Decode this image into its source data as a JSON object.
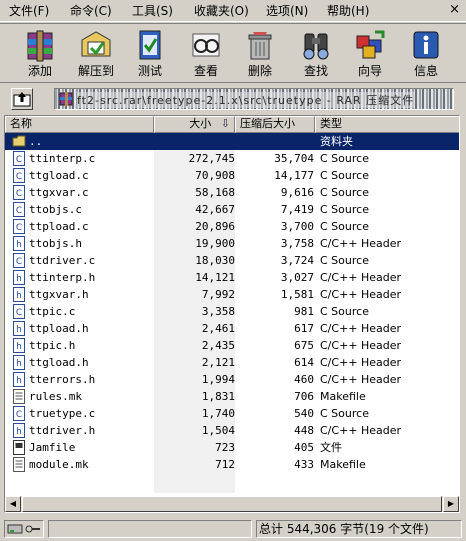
{
  "menu": {
    "items": [
      "文件(F)",
      "命令(C)",
      "工具(S)",
      "收藏夹(O)",
      "选项(N)",
      "帮助(H)"
    ],
    "close_glyph": "×"
  },
  "toolbar": {
    "buttons": [
      {
        "label": "添加",
        "icon": "add-archive-icon"
      },
      {
        "label": "解压到",
        "icon": "extract-to-icon"
      },
      {
        "label": "测试",
        "icon": "test-icon"
      },
      {
        "label": "查看",
        "icon": "view-icon"
      },
      {
        "label": "删除",
        "icon": "delete-icon"
      },
      {
        "label": "查找",
        "icon": "find-icon"
      },
      {
        "label": "向导",
        "icon": "wizard-icon"
      },
      {
        "label": "信息",
        "icon": "info-icon"
      }
    ]
  },
  "address": {
    "up_icon": "up-folder-icon",
    "path": "ft2-src.rar\\freetype-2.1.x\\src\\truetype - RAR 压缩文件"
  },
  "list": {
    "columns": {
      "name": "名称",
      "size": "大小",
      "packed": "压缩后大小",
      "type": "类型"
    },
    "sort_indicator": "⇩",
    "rows": [
      {
        "name": "..",
        "size": "",
        "packed": "",
        "type": "资料夹",
        "icon": "folder-up-icon",
        "selected": true
      },
      {
        "name": "ttinterp.c",
        "size": "272,745",
        "packed": "35,704",
        "type": "C Source",
        "icon": "c-file-icon"
      },
      {
        "name": "ttgload.c",
        "size": "70,908",
        "packed": "14,177",
        "type": "C Source",
        "icon": "c-file-icon"
      },
      {
        "name": "ttgxvar.c",
        "size": "58,168",
        "packed": "9,616",
        "type": "C Source",
        "icon": "c-file-icon"
      },
      {
        "name": "ttobjs.c",
        "size": "42,667",
        "packed": "7,419",
        "type": "C Source",
        "icon": "c-file-icon"
      },
      {
        "name": "ttpload.c",
        "size": "20,896",
        "packed": "3,700",
        "type": "C Source",
        "icon": "c-file-icon"
      },
      {
        "name": "ttobjs.h",
        "size": "19,900",
        "packed": "3,758",
        "type": "C/C++ Header",
        "icon": "h-file-icon"
      },
      {
        "name": "ttdriver.c",
        "size": "18,030",
        "packed": "3,724",
        "type": "C Source",
        "icon": "c-file-icon"
      },
      {
        "name": "ttinterp.h",
        "size": "14,121",
        "packed": "3,027",
        "type": "C/C++ Header",
        "icon": "h-file-icon"
      },
      {
        "name": "ttgxvar.h",
        "size": "7,992",
        "packed": "1,581",
        "type": "C/C++ Header",
        "icon": "h-file-icon"
      },
      {
        "name": "ttpic.c",
        "size": "3,358",
        "packed": "981",
        "type": "C Source",
        "icon": "c-file-icon"
      },
      {
        "name": "ttpload.h",
        "size": "2,461",
        "packed": "617",
        "type": "C/C++ Header",
        "icon": "h-file-icon"
      },
      {
        "name": "ttpic.h",
        "size": "2,435",
        "packed": "675",
        "type": "C/C++ Header",
        "icon": "h-file-icon"
      },
      {
        "name": "ttgload.h",
        "size": "2,121",
        "packed": "614",
        "type": "C/C++ Header",
        "icon": "h-file-icon"
      },
      {
        "name": "tterrors.h",
        "size": "1,994",
        "packed": "460",
        "type": "C/C++ Header",
        "icon": "h-file-icon"
      },
      {
        "name": "rules.mk",
        "size": "1,831",
        "packed": "706",
        "type": "Makefile",
        "icon": "makefile-icon"
      },
      {
        "name": "truetype.c",
        "size": "1,740",
        "packed": "540",
        "type": "C Source",
        "icon": "c-file-icon"
      },
      {
        "name": "ttdriver.h",
        "size": "1,504",
        "packed": "448",
        "type": "C/C++ Header",
        "icon": "h-file-icon"
      },
      {
        "name": "Jamfile",
        "size": "723",
        "packed": "405",
        "type": "文件",
        "icon": "generic-file-icon"
      },
      {
        "name": "module.mk",
        "size": "712",
        "packed": "433",
        "type": "Makefile",
        "icon": "makefile-icon"
      }
    ]
  },
  "status": {
    "drive_icon": "drive-key-icon",
    "summary": "总计 544,306 字节(19 个文件)"
  },
  "colors": {
    "selection": "#0a246a",
    "face": "#d4d0c8"
  }
}
